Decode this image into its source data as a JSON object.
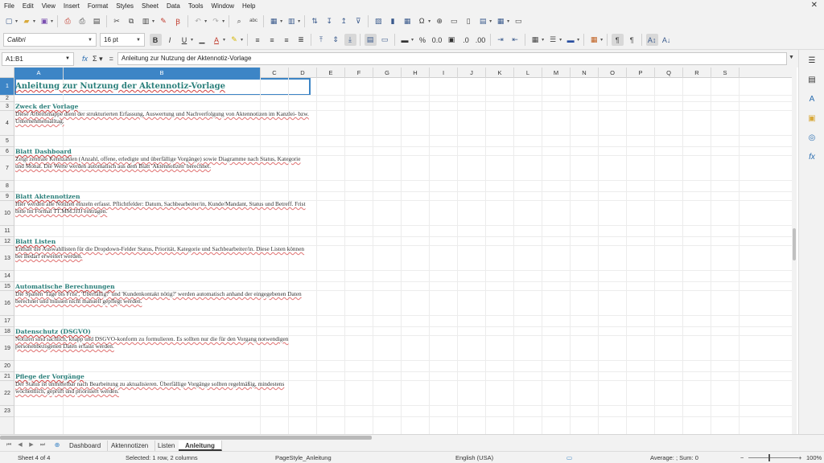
{
  "menubar": {
    "items": [
      "File",
      "Edit",
      "View",
      "Insert",
      "Format",
      "Styles",
      "Sheet",
      "Data",
      "Tools",
      "Window",
      "Help"
    ]
  },
  "toolbar1": {
    "icons": [
      "new-icon",
      "open-icon",
      "save-icon",
      "export-pdf-icon",
      "print-icon",
      "print-preview-icon",
      "cut-icon",
      "copy-icon",
      "paste-icon",
      "clone-formatting-icon",
      "clear-formatting-icon",
      "undo-icon",
      "redo-icon",
      "find-replace-icon",
      "spelling-icon",
      "row-icon",
      "column-icon",
      "sort-icon",
      "sort-ascending-icon",
      "sort-descending-icon",
      "autofilter-icon",
      "image-icon",
      "chart-icon",
      "pivot-table-icon",
      "special-character-icon",
      "hyperlink-icon",
      "comment-icon",
      "headers-footers-icon",
      "define-print-area-icon",
      "freeze-rows-columns-icon",
      "split-window-icon"
    ]
  },
  "toolbar2": {
    "font_name": "Calibri",
    "font_size": "16 pt"
  },
  "formulabar": {
    "cell_ref": "A1:B1",
    "content": "Anleitung zur Nutzung der Aktennotiz-Vorlage"
  },
  "columns": [
    "A",
    "B",
    "C",
    "D",
    "E",
    "F",
    "G",
    "H",
    "I",
    "J",
    "K",
    "L",
    "M",
    "N",
    "O",
    "P",
    "Q",
    "R",
    "S"
  ],
  "rows": [
    "1",
    "2",
    "3",
    "4",
    "5",
    "6",
    "7",
    "8",
    "9",
    "10",
    "11",
    "12",
    "13",
    "14",
    "15",
    "16",
    "17",
    "18",
    "19",
    "20",
    "21",
    "22",
    "23"
  ],
  "sheet": {
    "title": "Anleitung zur Nutzung der Aktennotiz-Vorlage",
    "sections": [
      {
        "heading": "Zweck der Vorlage",
        "body": "Diese Arbeitsmappe dient der strukturierten Erfassung, Auswertung und Nachverfolgung von Aktennotizen im Kanzlei- bzw. Unternehmensalltag."
      },
      {
        "heading": "Blatt Dashboard",
        "body": "Zeigt zentrale Kennzahlen (Anzahl, offene, erledigte und überfällige Vorgänge) sowie Diagramme nach Status, Kategorie und Monat. Die Werte werden automatisch aus dem Blatt 'Aktennotizen' berechnet."
      },
      {
        "heading": "Blatt Aktennotizen",
        "body": "Hier werden alle Notizen einzeln erfasst. Pflichtfelder: Datum, Sachbearbeiter/in, Kunde/Mandant, Status und Betreff. Frist bitte im Format TT.MM.JJJJ eintragen."
      },
      {
        "heading": "Blatt Listen",
        "body": "Enthält die Auswahllisten für die Dropdown-Felder Status, Priorität, Kategorie und Sachbearbeiter/in. Diese Listen können bei Bedarf erweitert werden."
      },
      {
        "heading": "Automatische Berechnungen",
        "body": "Die Spalten 'Tage bis Frist', 'Überfällig?' und 'Kundenkontakt nötig?' werden automatisch anhand der eingegebenen Daten berechnet und müssen nicht manuell gepflegt werden."
      },
      {
        "heading": "Datenschutz (DSGVO)",
        "body": "Notizen sind sachlich, knapp und DSGVO-konform zu formulieren. Es sollten nur die für den Vorgang notwendigen personenbezogenen Daten erfasst werden."
      },
      {
        "heading": "Pflege der Vorgänge",
        "body": "Der Status ist unmittelbar nach Bearbeitung zu aktualisieren. Überfällige Vorgänge sollten regelmäßig, mindestens wöchentlich, geprüft und priorisiert werden."
      }
    ]
  },
  "tabs": {
    "sheets": [
      "Dashboard",
      "Aktennotizen",
      "Listen",
      "Anleitung"
    ],
    "active": "Anleitung"
  },
  "statusbar": {
    "sheet": "Sheet 4 of 4",
    "selection": "Selected: 1 row, 2 columns",
    "page_style": "PageStyle_Anleitung",
    "language": "English (USA)",
    "summary": "Average: ; Sum: 0",
    "zoom": "100%"
  },
  "colors": {
    "accent": "#3d85c6",
    "heading": "#2a7f7a",
    "spellcheck": "#d04040"
  }
}
